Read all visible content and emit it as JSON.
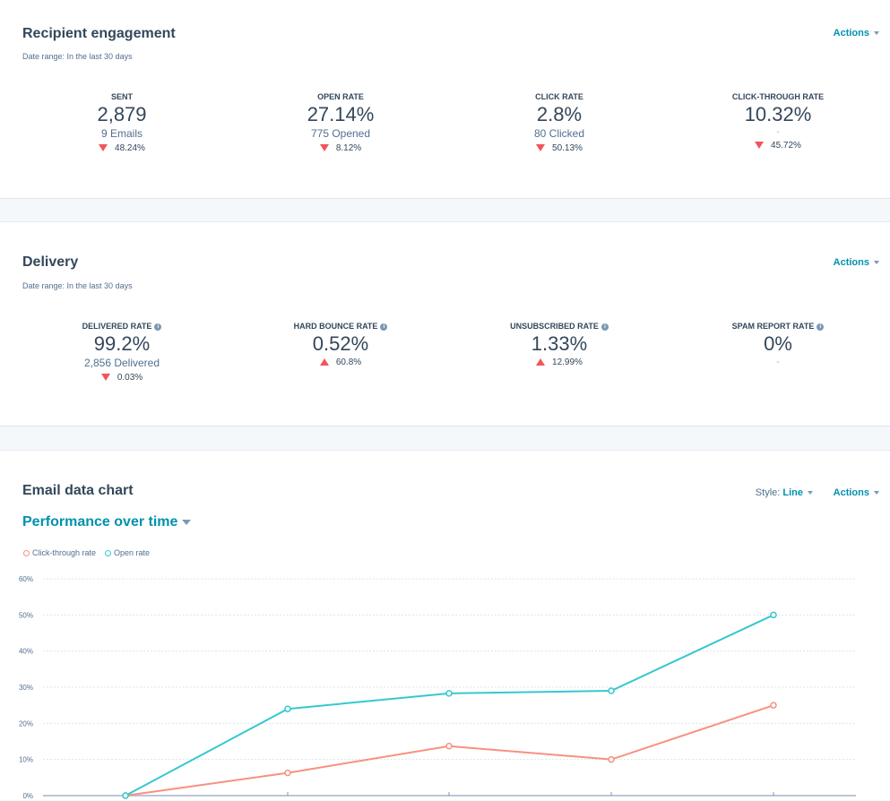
{
  "engagement": {
    "title": "Recipient engagement",
    "date_range": "Date range:  In the last 30 days",
    "actions_label": "Actions",
    "metrics": [
      {
        "label": "SENT",
        "value": "2,879",
        "sub": "9 Emails",
        "change": "48.24%",
        "direction": "down"
      },
      {
        "label": "OPEN RATE",
        "value": "27.14%",
        "sub": "775 Opened",
        "change": "8.12%",
        "direction": "down"
      },
      {
        "label": "CLICK RATE",
        "value": "2.8%",
        "sub": "80 Clicked",
        "change": "50.13%",
        "direction": "down"
      },
      {
        "label": "CLICK-THROUGH RATE",
        "value": "10.32%",
        "sub": "-",
        "change": "45.72%",
        "direction": "down"
      }
    ]
  },
  "delivery": {
    "title": "Delivery",
    "date_range": "Date range:  In the last 30 days",
    "actions_label": "Actions",
    "metrics": [
      {
        "label": "DELIVERED RATE",
        "value": "99.2%",
        "sub": "2,856 Delivered",
        "change": "0.03%",
        "direction": "down"
      },
      {
        "label": "HARD BOUNCE RATE",
        "value": "0.52%",
        "sub": "",
        "change": "60.8%",
        "direction": "up"
      },
      {
        "label": "UNSUBSCRIBED RATE",
        "value": "1.33%",
        "sub": "",
        "change": "12.99%",
        "direction": "up"
      },
      {
        "label": "SPAM REPORT RATE",
        "value": "0%",
        "sub": "",
        "change": "-",
        "direction": "none"
      }
    ]
  },
  "email_chart": {
    "title": "Email data chart",
    "style_label": "Style:",
    "style_value": "Line",
    "actions_label": "Actions",
    "view_title": "Performance over time"
  },
  "colors": {
    "accent": "#0091ae",
    "decline": "#f2545b",
    "open_rate": "#36c8cf",
    "click_through_rate": "#f8917f"
  },
  "chart_data": {
    "type": "line",
    "title": "Performance over time",
    "xlabel": "",
    "ylabel": "",
    "x": [
      "",
      "",
      "",
      "",
      ""
    ],
    "y_ticks": [
      "0%",
      "10%",
      "20%",
      "30%",
      "40%",
      "50%",
      "60%"
    ],
    "ylim": [
      0,
      60
    ],
    "grid": true,
    "legend": "top-left",
    "series": [
      {
        "name": "Click-through rate",
        "color": "#f8917f",
        "values": [
          0,
          6.3,
          13.7,
          10.0,
          25.0
        ]
      },
      {
        "name": "Open rate",
        "color": "#36c8cf",
        "values": [
          0,
          24.0,
          28.3,
          29.0,
          50.0
        ]
      }
    ]
  }
}
